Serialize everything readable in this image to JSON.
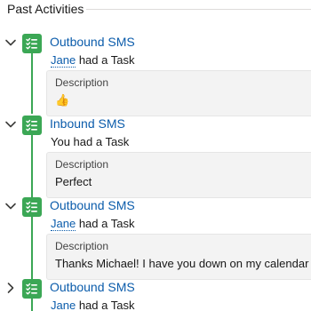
{
  "section": {
    "title": "Past Activities"
  },
  "activities": [
    {
      "subject": "Outbound SMS",
      "user": "Jane",
      "summary_suffix": " had a Task",
      "description_label": "Description",
      "description_value": "👍",
      "expanded": true
    },
    {
      "subject": "Inbound SMS",
      "user": "",
      "summary_suffix": "You had a Task",
      "description_label": "Description",
      "description_value": "Perfect",
      "expanded": true
    },
    {
      "subject": "Outbound SMS",
      "user": "Jane",
      "summary_suffix": " had a Task",
      "description_label": "Description",
      "description_value": "Thanks Michael! I have you down on my calendar for",
      "expanded": true
    },
    {
      "subject": "Outbound SMS",
      "user": "Jane",
      "summary_suffix": " had a Task",
      "expanded": false
    }
  ],
  "colors": {
    "task_icon": "#3ba755",
    "link": "#0b5cab"
  },
  "icons": {
    "expanded": "chevron-down-icon",
    "collapsed": "chevron-right-icon",
    "task": "task-icon"
  }
}
